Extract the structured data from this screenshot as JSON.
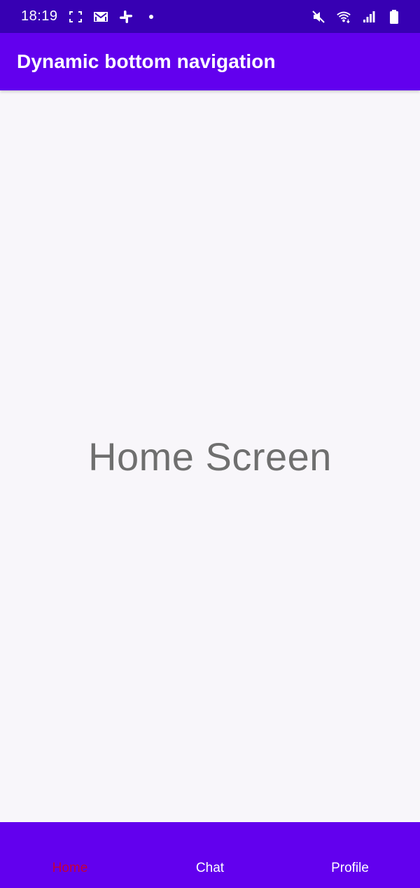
{
  "status_bar": {
    "time": "18:19",
    "left_icons": [
      "screenshot-frame-icon",
      "gmail-icon",
      "slack-icon",
      "dot-icon"
    ],
    "right_icons": [
      "mute-icon",
      "wifi-icon",
      "signal-icon",
      "battery-icon"
    ]
  },
  "app_bar": {
    "title": "Dynamic bottom navigation"
  },
  "main": {
    "screen_label": "Home Screen"
  },
  "bottom_nav": {
    "items": [
      {
        "label": "Home",
        "active": true
      },
      {
        "label": "Chat",
        "active": false
      },
      {
        "label": "Profile",
        "active": false
      }
    ],
    "active_color": "#c2003c",
    "inactive_color": "#ffffff"
  },
  "colors": {
    "status_bar": "#3700b3",
    "primary": "#6200ee",
    "background": "#f8f6fa",
    "screen_text": "#6f6f6f"
  }
}
